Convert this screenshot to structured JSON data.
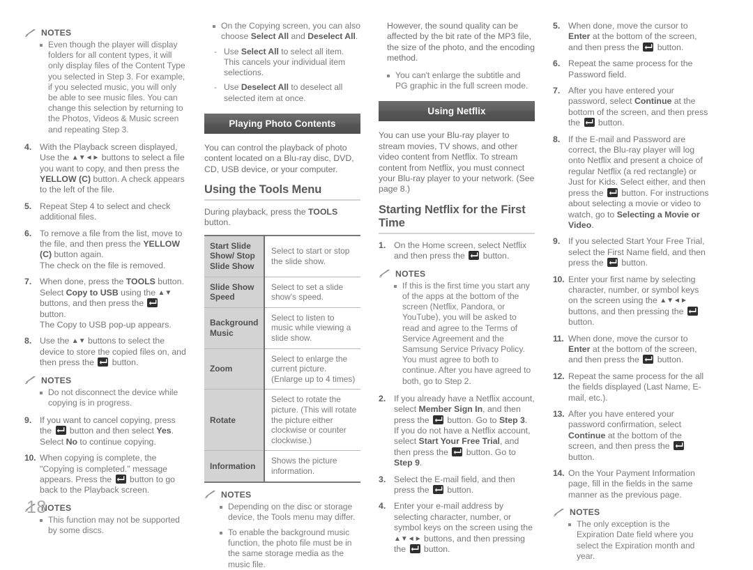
{
  "page": {
    "number": "18"
  },
  "icons": {
    "enter_button": "enter-button-icon",
    "pencil": "pencil-icon",
    "arrows_updownleftright": "▲▼◄►",
    "arrows_updown": "▲▼"
  },
  "labels": {
    "notes": "NOTES"
  },
  "col1": {
    "notes1": {
      "title": "NOTES",
      "items": [
        "Even though the player will display folders for all content types, it will only display files of the Content Type you selected in Step 3. For example, if you selected music, you will only be able to see music files. You can change this selection by returning to the Photos, Videos & Music screen and repeating Step 3."
      ]
    },
    "steps": [
      {
        "num": "4.",
        "html": "With the Playback screen displayed, Use the <span class=\"arrows\">▲▼◄►</span> buttons to select a file you want to copy, and then press the <b>YELLOW (C)</b> button. A check appears to the left of the file."
      },
      {
        "num": "5.",
        "html": "Repeat Step 4 to select and check additional files."
      },
      {
        "num": "6.",
        "html": "To remove a file from the list, move to the file, and then press the <b>YELLOW (C)</b> button again.<br>The check on the file is removed."
      },
      {
        "num": "7.",
        "html": "When done, press the <b>TOOLS</b> button. Select <b>Copy to USB</b> using the <span class=\"arrows\">▲▼</span> buttons, and then press the [ENTER] button.<br>The Copy to USB pop-up appears."
      },
      {
        "num": "8.",
        "html": "Use the <span class=\"arrows\">▲▼</span> buttons to select the device to store the copied files on, and then press the [ENTER] button."
      }
    ],
    "notes2": {
      "title": "NOTES",
      "items": [
        "Do not disconnect the device while copying is in progress."
      ]
    },
    "steps2": [
      {
        "num": "9.",
        "html": "If you want to cancel copying, press the [ENTER] button and then select <b>Yes</b>. Select <b>No</b> to continue copying."
      },
      {
        "num": "10.",
        "html": "When copying is complete, the \"Copying is completed.\" message appears. Press the [ENTER] button to go back to the Playback screen."
      }
    ],
    "notes3": {
      "title": "NOTES",
      "items": [
        "This function may not be supported by some discs."
      ]
    }
  },
  "col2": {
    "bullets": [
      {
        "html": "On the Copying screen, you can also choose <b>Select All</b> and <b>Deselect All</b>."
      }
    ],
    "dashes": [
      {
        "html": "Use <b>Select All</b> to select all item. This cancels your individual item selections."
      },
      {
        "html": "Use <b>Deselect All</b> to deselect all selected item at once."
      }
    ],
    "section_title": "Playing Photo Contents",
    "intro": "You can control the playback of photo content located on a Blu-ray disc, DVD, CD, USB device, or your computer.",
    "sub_head": "Using the Tools Menu",
    "sub_intro_html": "During playback, press the <b>TOOLS</b> button.",
    "table": [
      {
        "key": "Start Slide Show/ Stop Slide Show",
        "value": "Select to start or stop the slide show."
      },
      {
        "key": "Slide Show Speed",
        "value": "Select to set a slide show's speed."
      },
      {
        "key": "Background Music",
        "value": "Select to listen to music while viewing a slide show."
      },
      {
        "key": "Zoom",
        "value": "Select to enlarge the current picture. (Enlarge up to 4 times)"
      },
      {
        "key": "Rotate",
        "value": "Select to rotate the picture. (This will rotate the picture either clockwise or counter clockwise.)"
      },
      {
        "key": "Information",
        "value": "Shows the picture information."
      }
    ],
    "notes": {
      "title": "NOTES",
      "items": [
        "Depending on the disc or storage device, the Tools menu may differ.",
        "To enable the background music function, the photo file must be in the same storage media as the music file."
      ]
    }
  },
  "col3": {
    "cont_text": "However, the sound quality can be affected by the bit rate of the MP3 file, the size of the photo, and the encoding method.",
    "bullets": [
      {
        "html": "You can't enlarge the subtitle and PG graphic in the full screen mode."
      }
    ],
    "section_title": "Using Netflix",
    "intro": "You can use your Blu-ray player to stream movies, TV shows, and other video content from Netflix. To stream content from Netflix, you must connect your Blu-ray player to your network. (See page 8.)",
    "sub_head": "Starting Netflix for the First Time",
    "steps": [
      {
        "num": "1.",
        "html": "On the Home screen, select Netflix and then press the [ENTER] button."
      }
    ],
    "notes": {
      "title": "NOTES",
      "items": [
        "If this is the first time you start any of the apps at the bottom of the screen (Netflix, Pandora, or YouTube), you will be asked to read and agree to the Terms of Service Agreement and the Samsung Service Privacy Policy. You must agree to both to continue. After you have agreed to both, go to Step 2."
      ]
    },
    "steps2": [
      {
        "num": "2.",
        "html": "If you already have a Netflix account, select <b>Member Sign In</b>, and then press the [ENTER] button. Go to <b>Step 3</b>.<br>If you do not have a Netflix account, select <b>Start Your Free Trial</b>, and then press the [ENTER] button. Go to <b>Step 9</b>."
      },
      {
        "num": "3.",
        "html": "Select the E-mail field, and then press the [ENTER] button."
      },
      {
        "num": "4.",
        "html": "Enter your e-mail address by selecting character, number, or symbol keys on the screen using the <span class=\"arrows\">▲▼◄►</span> buttons, and then pressing the [ENTER] button."
      }
    ]
  },
  "col4": {
    "steps": [
      {
        "num": "5.",
        "html": "When done, move the cursor to <b>Enter</b> at the bottom of the screen, and then press the [ENTER] button."
      },
      {
        "num": "6.",
        "html": "Repeat the same process for the Password field."
      },
      {
        "num": "7.",
        "html": "After you have entered your password, select <b>Continue</b> at the bottom of the screen, and then press the [ENTER] button."
      },
      {
        "num": "8.",
        "html": "If the E-mail and Password are correct, the Blu-ray player will log onto Netflix and present a choice of regular Netflix (a red rectangle) or Just for Kids. Select either, and then press the [ENTER] button. For instructions about selecting a movie or video to watch, go to <b>Selecting a Movie or Video</b>."
      },
      {
        "num": "9.",
        "html": "If you selected Start Your Free Trial, select the First Name field, and then press the [ENTER] button."
      },
      {
        "num": "10.",
        "html": "Enter your first name by selecting character, number, or symbol keys on the screen using the <span class=\"arrows\">▲▼◄►</span> buttons, and then pressing the [ENTER] button."
      },
      {
        "num": "11.",
        "html": "When done, move the cursor to <b>Enter</b> at the bottom of the screen, and then press the [ENTER] button."
      },
      {
        "num": "12.",
        "html": "Repeat the same process for the all the fields displayed (Last Name, E-mail, etc.)."
      },
      {
        "num": "13.",
        "html": "After you have entered your password confirmation, select <b>Continue</b> at the bottom of the screen, and then press the [ENTER] button."
      },
      {
        "num": "14.",
        "html": "On the Your Payment Information page, fill in the fields in the same manner as the previous page."
      }
    ],
    "notes": {
      "title": "NOTES",
      "items": [
        "The only exception is the Expiration Date field where you select the Expiration month and year."
      ]
    }
  }
}
